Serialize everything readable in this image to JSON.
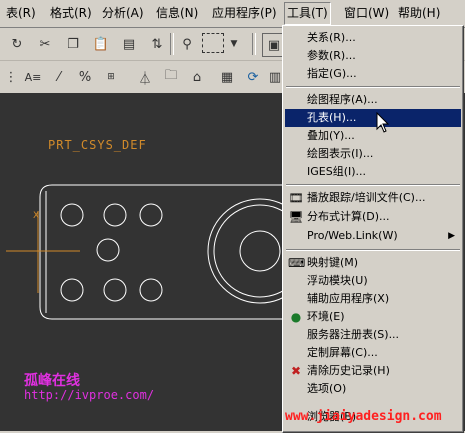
{
  "menubar": {
    "items": [
      "表(R)",
      "格式(R)",
      "分析(A)",
      "信息(N)",
      "应用程序(P)",
      "工具(T)",
      "窗口(W)",
      "帮助(H)"
    ]
  },
  "tools_menu": {
    "items": [
      "关系(R)...",
      "参数(R)...",
      "指定(G)...",
      "绘图程序(A)...",
      "孔表(H)...",
      "叠加(Y)...",
      "绘图表示(I)...",
      "IGES组(I)...",
      "播放跟踪/培训文件(C)...",
      "分布式计算(D)...",
      "Pro/Web.Link(W)",
      "映射键(M)",
      "浮动模块(U)",
      "辅助应用程序(X)",
      "环境(E)",
      "服务器注册表(S)...",
      "定制屏幕(C)...",
      "清除历史记录(H)",
      "选项(O)",
      "浏览器(B)"
    ]
  },
  "canvas": {
    "csys_label": "PRT_CSYS_DEF",
    "axis_label": "X"
  },
  "watermarks": {
    "site_name": "孤峰在线",
    "site_url": "http://ivproe.com/",
    "brand": "www.jiaiyadesign.com"
  },
  "colors": {
    "highlight": "#0a246a",
    "canvas_bg": "#333333",
    "csys": "#d18a2a",
    "watermark_magenta": "#e030e0",
    "watermark_red": "#ff2020"
  }
}
